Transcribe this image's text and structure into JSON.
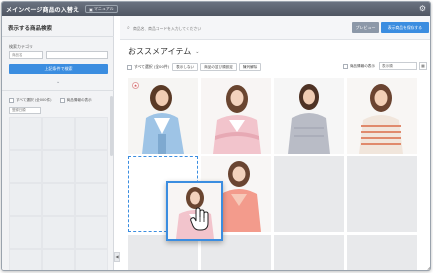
{
  "window": {
    "title": "メインページ商品の入替え",
    "manual_label": "マニュアル"
  },
  "left_panel": {
    "heading": "表示する商品検索",
    "category_label": "検索カテゴリ",
    "category_select": "商品名",
    "search_button": "上記条件で検索",
    "select_all": "すべて選択 (全000件)",
    "show_info": "商品情報の表示",
    "sort_select": "登録日順"
  },
  "main": {
    "search_placeholder": "商品名、商品コードを入力してください",
    "preview_button": "プレビュー",
    "publish_button": "表示商品を保存する",
    "section_title": "おススメアイテム",
    "toolbar": {
      "select_all": "すべて選択 (全00件)",
      "hide_button": "表示しない",
      "bulk_change_button": "商品の並び順設定",
      "list_button": "陳列解除",
      "show_info": "商品情報の表示",
      "order_select": "表示順"
    },
    "badge": "★"
  },
  "colors": {
    "accent": "#3b8de0",
    "titlebar": "#565d69",
    "tile_placeholder": "#e8e9eb"
  },
  "icons": {
    "gear": "gear-icon",
    "search": "search-icon",
    "hand": "hand-cursor-icon"
  }
}
